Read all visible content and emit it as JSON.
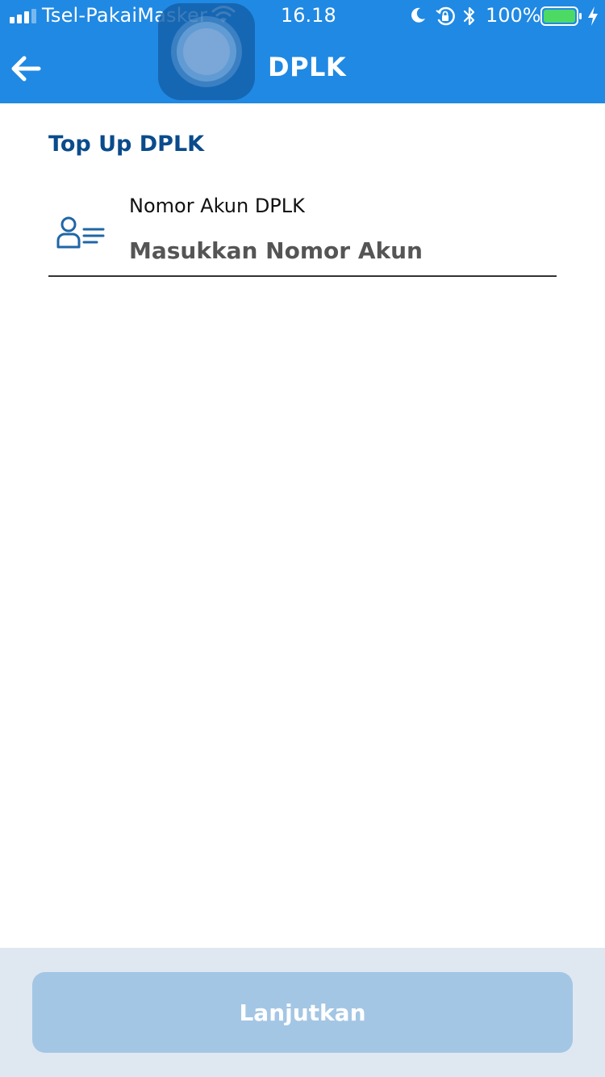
{
  "status_bar": {
    "carrier": "Tsel-PakaiMasker",
    "time": "16.18",
    "battery": "100%"
  },
  "header": {
    "title": "DPLK"
  },
  "section": {
    "title": "Top Up DPLK"
  },
  "account_field": {
    "label": "Nomor Akun DPLK",
    "value": "",
    "placeholder": "Masukkan Nomor Akun"
  },
  "footer": {
    "next_label": "Lanjutkan"
  },
  "colors": {
    "header": "#2089e3",
    "section_title": "#0a4b8c",
    "icon": "#1f66a6",
    "button_disabled": "#a3c6e4",
    "footer_bg": "#dfe7f1",
    "battery": "#4cd964"
  },
  "icons": {
    "back": "arrow-left-icon",
    "account": "user-list-icon",
    "assistive_touch": "assistive-touch-button"
  }
}
